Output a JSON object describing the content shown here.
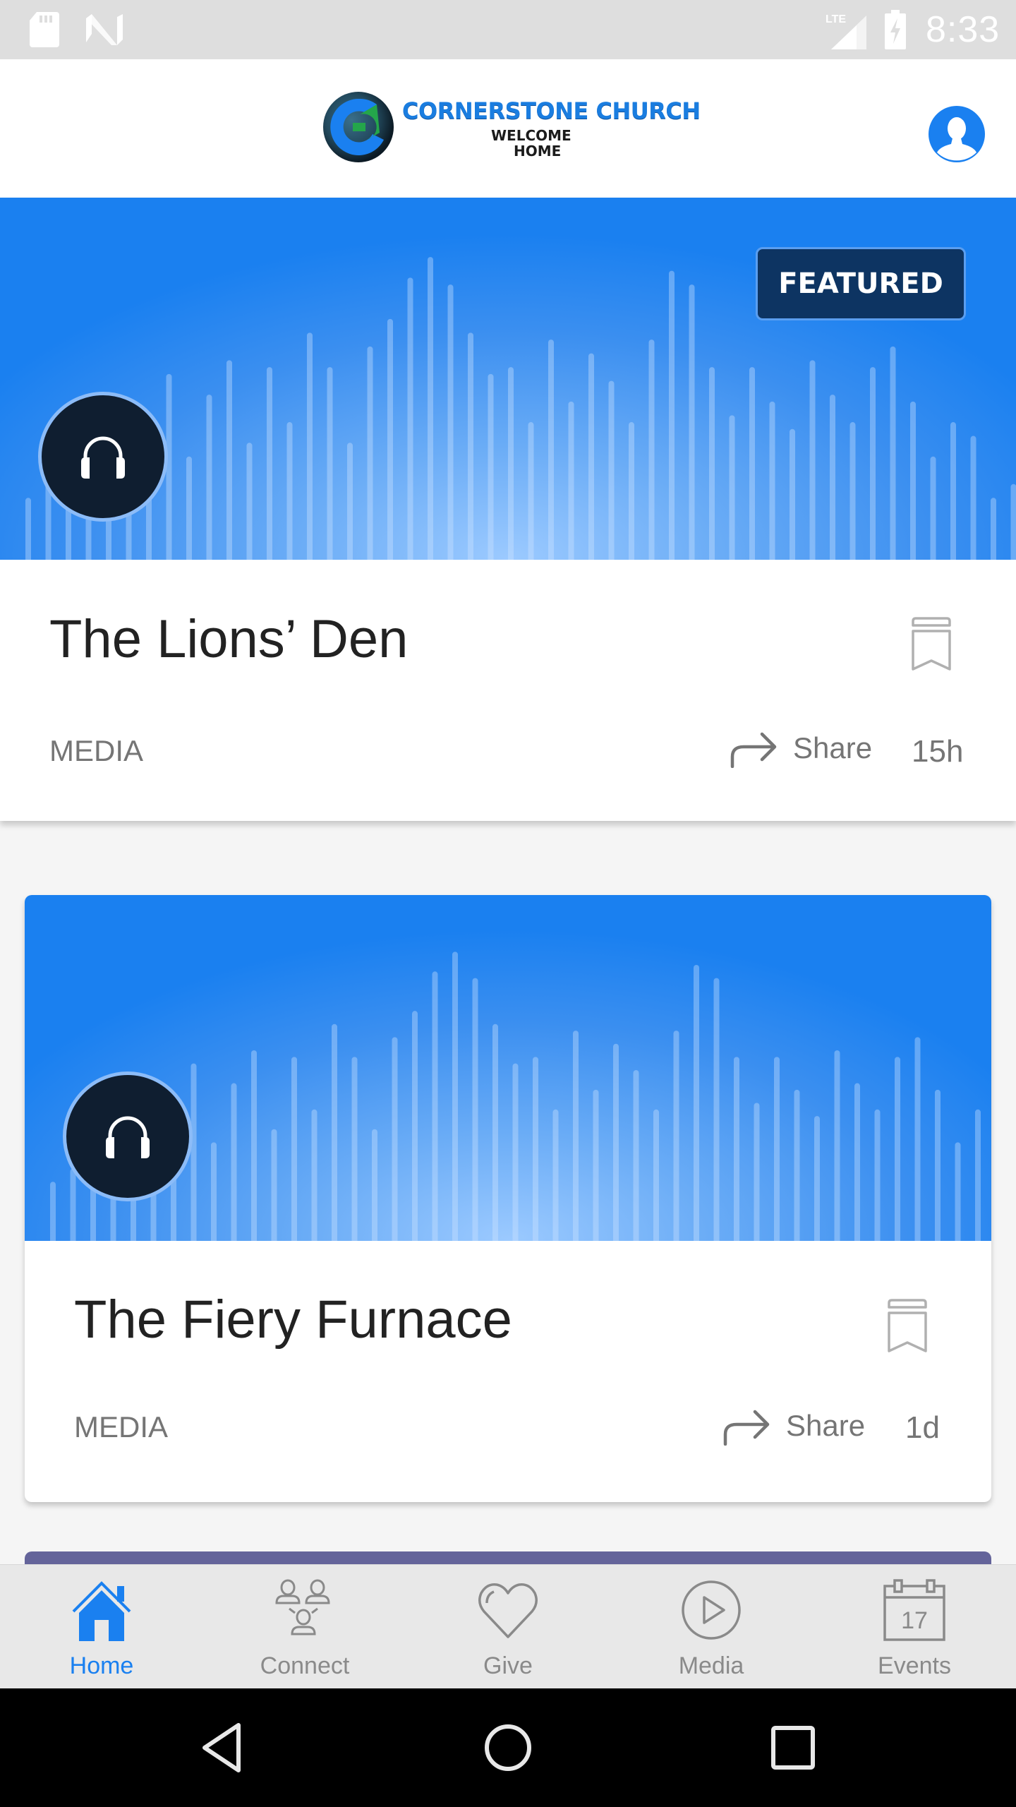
{
  "status_bar": {
    "time": "8:33",
    "left_icons": [
      "sd-card-icon",
      "n-notification-icon"
    ],
    "right_icons": [
      "lte-signal-icon",
      "battery-charging-icon"
    ]
  },
  "header": {
    "logo": {
      "title": "CORNERSTONE CHURCH",
      "tagline_line1": "WELCOME",
      "tagline_line2": "HOME"
    },
    "profile_icon": "user-profile-icon",
    "colors": {
      "brand": "#1a80f0"
    }
  },
  "feed": [
    {
      "title": "The Lions’ Den",
      "category": "MEDIA",
      "share_label": "Share",
      "age": "15h",
      "featured": true,
      "featured_label": "FEATURED",
      "media_icon": "headphones-icon"
    },
    {
      "title": "The Fiery Furnace",
      "category": "MEDIA",
      "share_label": "Share",
      "age": "1d",
      "featured": false,
      "media_icon": "headphones-icon"
    },
    {
      "partially_visible": true,
      "color": "#64649a"
    }
  ],
  "bottom_nav": {
    "active": "Home",
    "items": [
      {
        "label": "Home",
        "icon": "home-icon"
      },
      {
        "label": "Connect",
        "icon": "connect-people-icon"
      },
      {
        "label": "Give",
        "icon": "heart-icon"
      },
      {
        "label": "Media",
        "icon": "play-circle-icon"
      },
      {
        "label": "Events",
        "icon": "calendar-icon",
        "icon_text": "17"
      }
    ],
    "colors": {
      "active": "#1a80f0",
      "inactive": "#8a8a8a"
    }
  },
  "system_nav": {
    "buttons": [
      "back-icon",
      "home-circle-icon",
      "recents-icon"
    ]
  }
}
